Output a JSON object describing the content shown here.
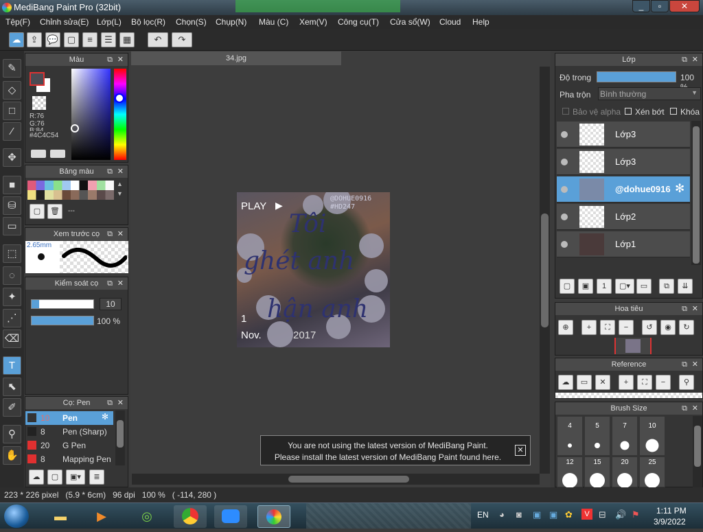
{
  "window": {
    "title": "MediBang Paint Pro (32bit)"
  },
  "menu": [
    "Tệp(F)",
    "Chỉnh sửa(E)",
    "Lớp(L)",
    "Bộ lọc(R)",
    "Chọn(S)",
    "Chụp(N)",
    "Màu (C)",
    "Xem(V)",
    "Công cụ(T)",
    "Cửa sổ(W)",
    "Cloud",
    "Help"
  ],
  "color_panel": {
    "title": "Màu",
    "r": "R:76",
    "g": "G:76",
    "b": "B:84",
    "hex": "#4C4C54"
  },
  "palette_panel": {
    "title": "Bảng màu",
    "name": "---"
  },
  "brush_preview": {
    "title": "Xem trước cọ",
    "size": "2.65mm"
  },
  "brush_control": {
    "title": "Kiểm soát cọ",
    "size_value": "10",
    "opacity_value": "100 %",
    "size_level": 0.12,
    "opacity_level": 1.0
  },
  "brush_list": {
    "title": "Cọ: Pen",
    "items": [
      {
        "size": "10",
        "name": "Pen",
        "color": "#333333"
      },
      {
        "size": "8",
        "name": "Pen (Sharp)",
        "color": "#222222"
      },
      {
        "size": "20",
        "name": "G Pen",
        "color": "#e03030"
      },
      {
        "size": "8",
        "name": "Mapping Pen",
        "color": "#e03030"
      }
    ]
  },
  "canvas": {
    "tab": "34.jpg"
  },
  "artwork": {
    "play": "PLAY",
    "handle": "@DOHUE0916",
    "tag": "#HD247",
    "line1": "Tôi",
    "line2": "ghét anh",
    "line3": "hận anh",
    "date_left": "Nov.",
    "date_right": "2017",
    "num": "1"
  },
  "notice": {
    "line1": "You are not using the latest version of MediBang Paint.",
    "line2": "Please install the latest version of MediBang Paint found here."
  },
  "layers_panel": {
    "title": "Lớp",
    "opacity_label": "Độ trong",
    "opacity_value": "100 %",
    "opacity_level": 1.0,
    "blend_label": "Pha trộn",
    "blend_value": "Bình thường",
    "alpha_protect": "Bảo vệ alpha",
    "clipping": "Xén bớt",
    "lock": "Khóa",
    "layers": [
      "Lớp3",
      "Lớp3",
      "@dohue0916",
      "Lớp2",
      "Lớp1"
    ]
  },
  "navigator": {
    "title": "Hoa tiêu"
  },
  "reference": {
    "title": "Reference"
  },
  "brush_size": {
    "title": "Brush Size",
    "sizes": [
      "4",
      "5",
      "7",
      "10",
      "12",
      "15",
      "20",
      "25"
    ]
  },
  "status": {
    "text": "223 * 226 pixel   (5.9 * 6cm)   96 dpi   100 %   ( -114, 280 )"
  },
  "taskbar": {
    "lang": "EN",
    "time": "1:11 PM",
    "date": "3/9/2022"
  },
  "colors": {
    "accent": "#5aa0d8",
    "panel": "#353535",
    "header": "#4a4a4a"
  }
}
